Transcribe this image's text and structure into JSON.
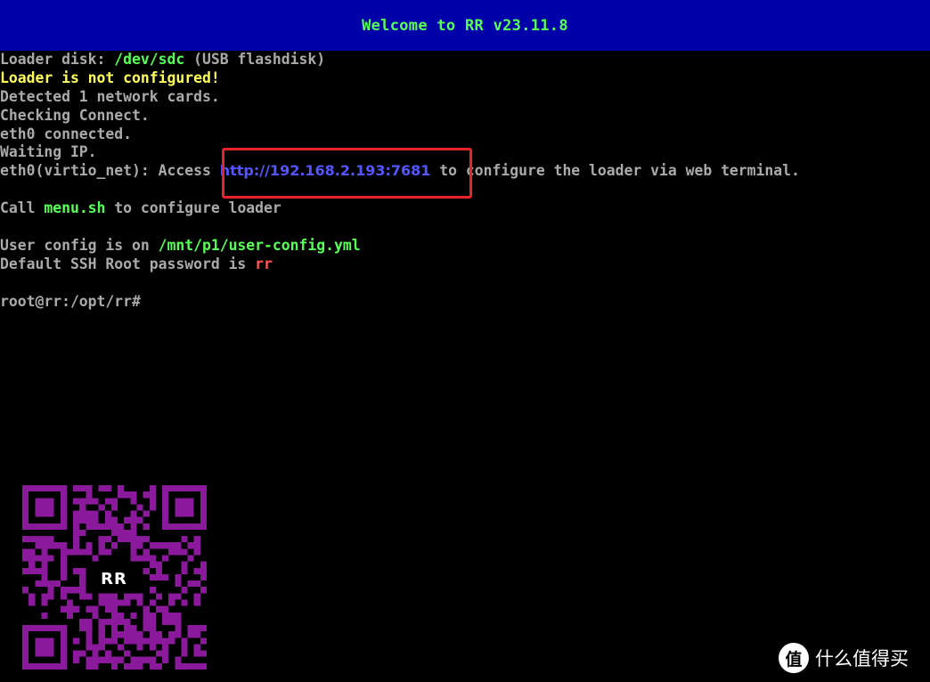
{
  "banner": {
    "title": "Welcome to RR v23.11.8",
    "color": "#55ff55",
    "background": "#0000a8"
  },
  "console": {
    "line1": {
      "prefix": "Loader disk: ",
      "path": "/dev/sdc",
      "suffix": " (USB flashdisk)"
    },
    "line2": "Loader is not configured!",
    "line3": "Detected 1 network cards.",
    "line4": "Checking Connect.",
    "line5": "eth0 connected.",
    "line6": "Waiting IP.",
    "line7": {
      "prefix": "eth0(virtio_net): Access ",
      "url": "http://192.168.2.193:7681",
      "suffix": " to configure the loader via web terminal."
    },
    "line9": {
      "prefix": "Call ",
      "command": "menu.sh",
      "suffix": " to configure loader"
    },
    "line11": {
      "prefix": "User config is on ",
      "path": "/mnt/p1/user-config.yml"
    },
    "line12": {
      "prefix": "Default SSH Root password is ",
      "password": "rr"
    },
    "prompt": "root@rr:/opt/rr#"
  },
  "qr": {
    "label": "RR",
    "color": "#8a1a9b"
  },
  "watermark": {
    "icon_glyph": "值",
    "text": "什么值得买"
  },
  "colors": {
    "text": "#aaaaaa",
    "green": "#55ff55",
    "yellow": "#ffff55",
    "red": "#ff5555",
    "link": "#5555ff",
    "highlight": "#e8242b"
  }
}
